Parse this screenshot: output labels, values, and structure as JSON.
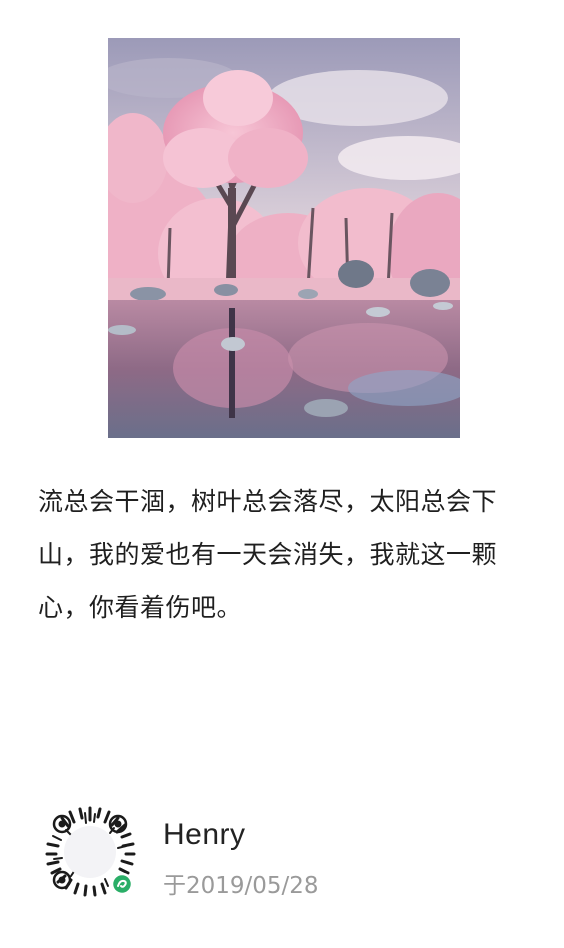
{
  "post": {
    "image": {
      "description_icon": "photo-pink-trees-lake"
    },
    "quote": "流总会干涸，树叶总会落尽，太阳总会下山，我的爱也有一天会消失，我就这一颗心，你看着伤吧。"
  },
  "footer": {
    "qr_icon": "miniprogram-qr-code-icon",
    "author": "Henry",
    "date": "于2019/05/28"
  },
  "colors": {
    "text": "#1f1f1f",
    "muted": "#9a9a9a",
    "accent_green": "#2aae67"
  }
}
